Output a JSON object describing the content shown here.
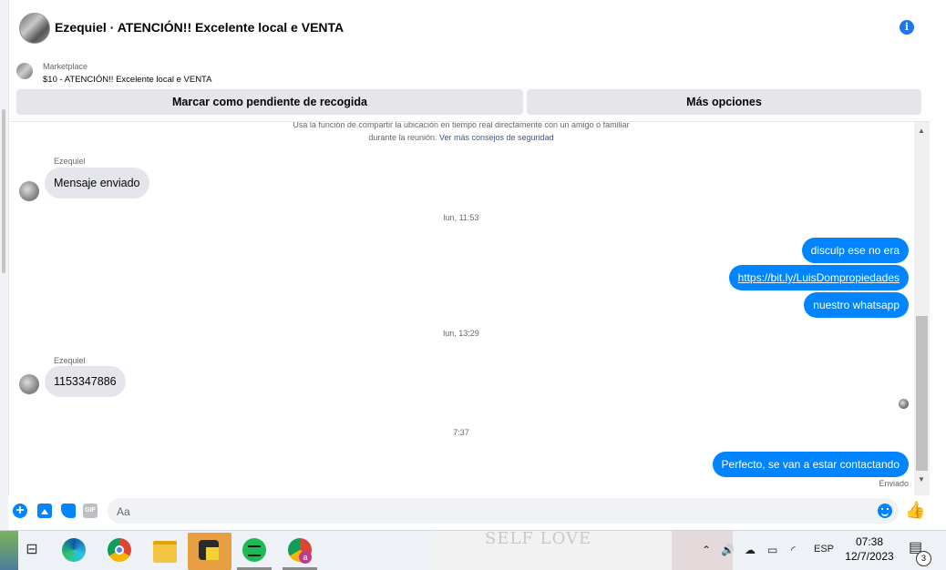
{
  "header": {
    "title": "Ezequiel · ATENCIÓN!! Excelente local e VENTA",
    "info_icon": "info-icon"
  },
  "marketplace": {
    "label": "Marketplace",
    "listing": "$10 - ATENCIÓN!! Excelente local e VENTA"
  },
  "actions": {
    "pending": "Marcar como pendiente de recogida",
    "more": "Más opciones"
  },
  "notice": {
    "text": "Usa la función de compartir la ubicación en tiempo real directamente con un amigo o familiar durante la reunión.",
    "link": "Ver más consejos de seguridad"
  },
  "messages": {
    "sender1": "Ezequiel",
    "msg1": "Mensaje enviado",
    "time1": "lun, 11:53",
    "out1": "disculp ese no era",
    "out2": "https://bit.ly/LuisDompropiedades",
    "out3": "nuestro whatsapp",
    "time2": "lun, 13:29",
    "sender2": "Ezequiel",
    "msg2": "1153347886",
    "time3": "7:37",
    "out4": "Perfecto, se van a estar contactando",
    "status": "Enviado"
  },
  "composer": {
    "placeholder": "Aa",
    "gif": "GIF"
  },
  "taskbar": {
    "wallpaper_text": "SELF LOVE",
    "language": "ESP",
    "time": "07:38",
    "date": "12/7/2023",
    "notifications": "3",
    "chrome_profile": "a"
  },
  "colors": {
    "accent": "#0084ff",
    "bubble_in": "#e4e6eb",
    "button": "#e4e6eb"
  }
}
